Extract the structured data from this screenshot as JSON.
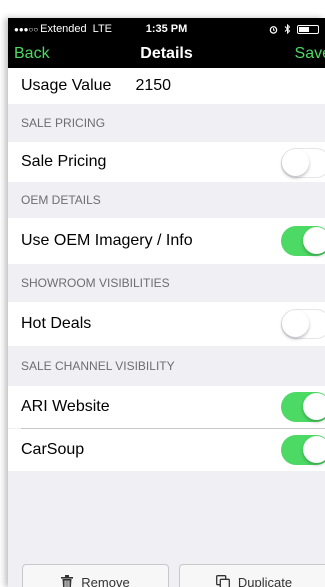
{
  "status_bar": {
    "signal": "●●●○○",
    "carrier": "Extended",
    "network": "LTE",
    "time": "1:35 PM"
  },
  "nav": {
    "back_label": "Back",
    "title": "Details",
    "save_label": "Save"
  },
  "usage": {
    "label": "Usage Value",
    "value": "2150"
  },
  "sections": {
    "sale_pricing_header": "SALE PRICING",
    "oem_details_header": "OEM DETAILS",
    "showroom_header": "SHOWROOM VISIBILITIES",
    "sale_channel_header": "SALE CHANNEL VISIBILITY"
  },
  "rows": {
    "sale_pricing": {
      "label": "Sale Pricing",
      "on": false
    },
    "oem_imagery": {
      "label": "Use OEM Imagery / Info",
      "on": true
    },
    "hot_deals": {
      "label": "Hot Deals",
      "on": false
    },
    "ari_website": {
      "label": "ARI Website",
      "on": true
    },
    "carsoup": {
      "label": "CarSoup",
      "on": true
    }
  },
  "actions": {
    "remove_label": "Remove",
    "duplicate_label": "Duplicate"
  },
  "colors": {
    "accent_green": "#4cd964",
    "nav_background": "#000000",
    "group_background": "#efeff4"
  },
  "icons": {
    "remove": "trash-icon",
    "duplicate": "duplicate-icon",
    "alarm": "alarm-icon",
    "bluetooth": "bluetooth-icon",
    "battery": "battery-icon"
  }
}
